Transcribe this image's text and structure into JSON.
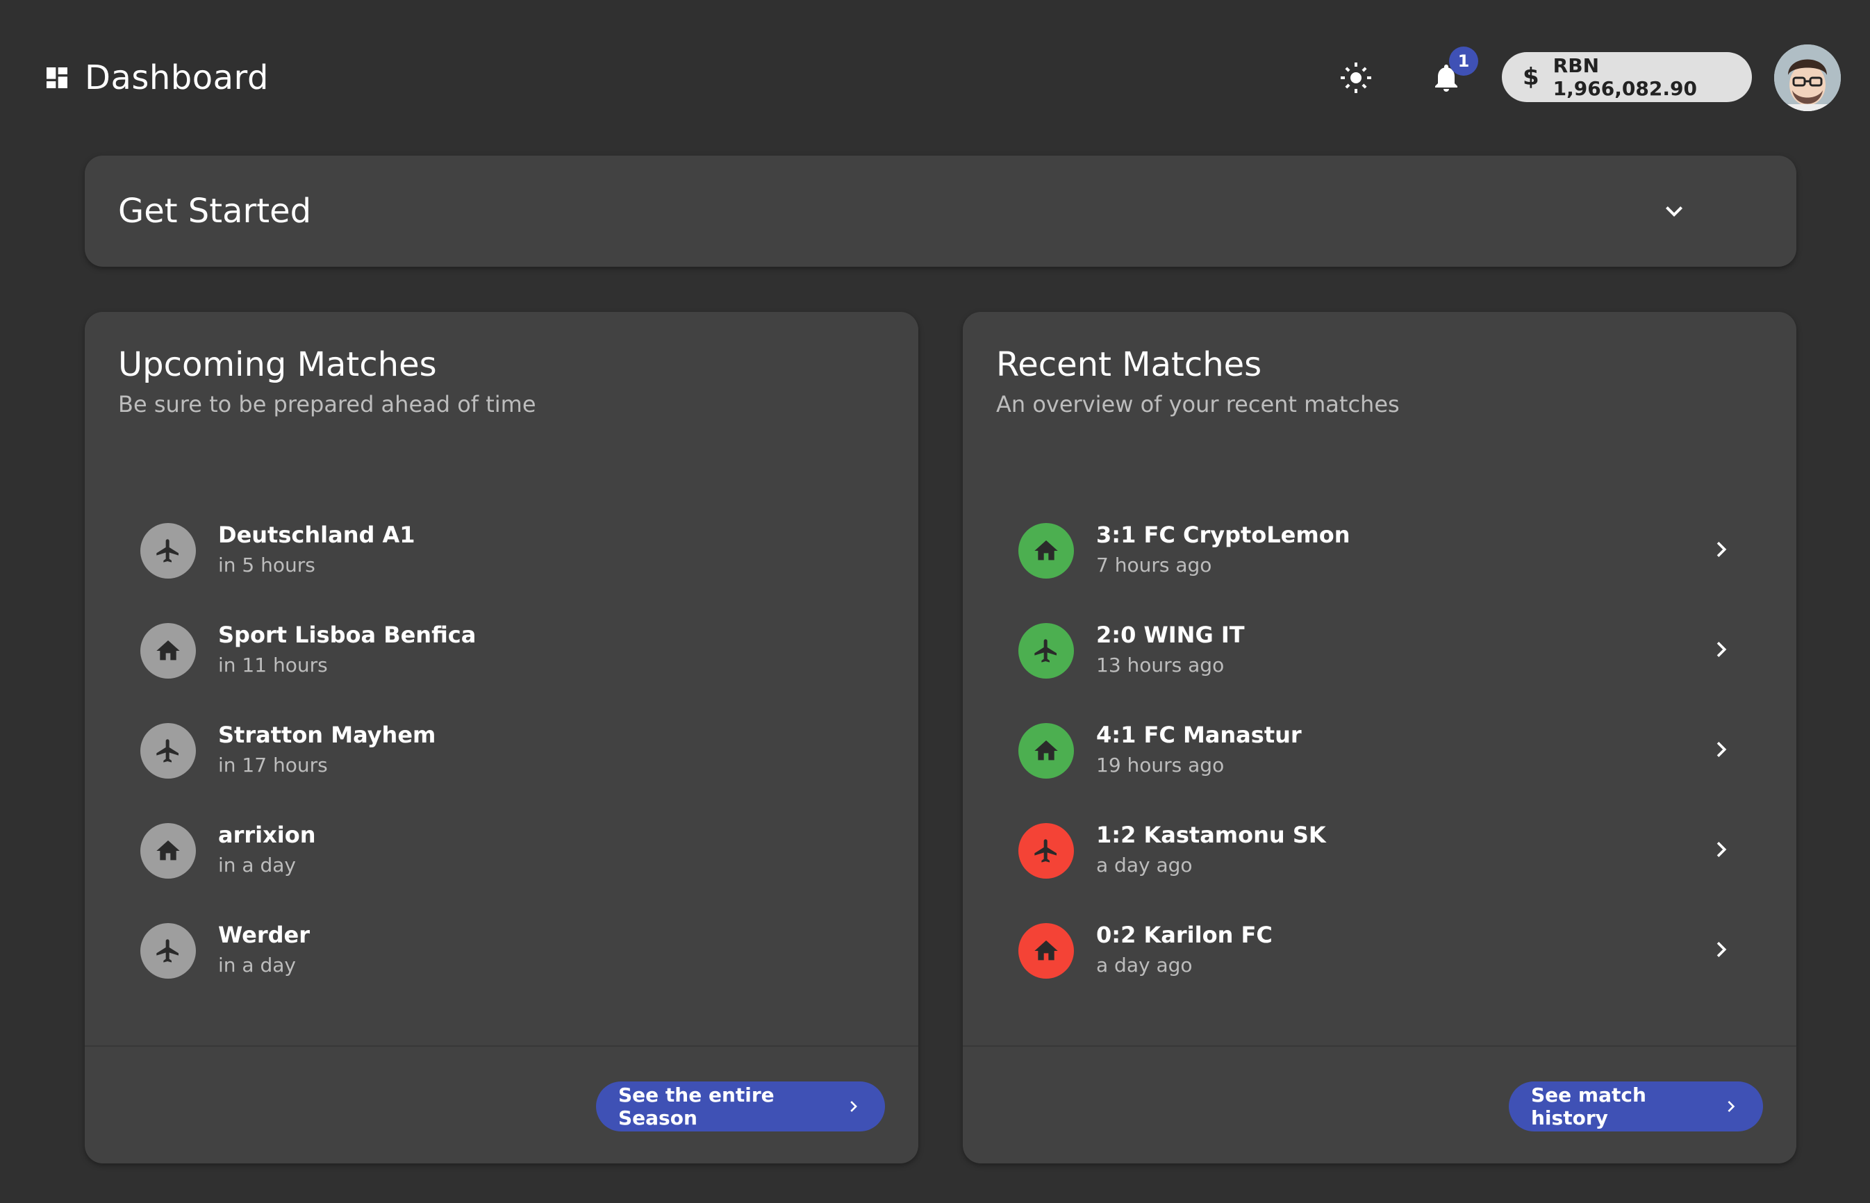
{
  "header": {
    "title": "Dashboard",
    "notification_count": "1",
    "balance_symbol": "$",
    "balance": "RBN 1,966,082.90"
  },
  "get_started": {
    "title": "Get Started"
  },
  "upcoming": {
    "title": "Upcoming Matches",
    "subtitle": "Be sure to be prepared ahead of time",
    "items": [
      {
        "team": "Deutschland A1",
        "time": "in 5 hours",
        "venue_icon": "airplane-icon"
      },
      {
        "team": "Sport Lisboa Benfica",
        "time": "in 11 hours",
        "venue_icon": "home-icon"
      },
      {
        "team": "Stratton Mayhem",
        "time": "in 17 hours",
        "venue_icon": "airplane-icon"
      },
      {
        "team": "arrixion",
        "time": "in a day",
        "venue_icon": "home-icon"
      },
      {
        "team": "Werder",
        "time": "in a day",
        "venue_icon": "airplane-icon"
      }
    ],
    "action_label": "See the entire Season"
  },
  "recent": {
    "title": "Recent Matches",
    "subtitle": "An overview of your recent matches",
    "items": [
      {
        "result": "3:1 FC CryptoLemon",
        "time": "7 hours ago",
        "venue_icon": "home-icon",
        "outcome": "win"
      },
      {
        "result": "2:0 WING IT",
        "time": "13 hours ago",
        "venue_icon": "airplane-icon",
        "outcome": "win"
      },
      {
        "result": "4:1 FC Manastur",
        "time": "19 hours ago",
        "venue_icon": "home-icon",
        "outcome": "win"
      },
      {
        "result": "1:2 Kastamonu SK",
        "time": "a day ago",
        "venue_icon": "airplane-icon",
        "outcome": "loss"
      },
      {
        "result": "0:2 Karilon FC",
        "time": "a day ago",
        "venue_icon": "home-icon",
        "outcome": "loss"
      }
    ],
    "action_label": "See match history"
  },
  "colors": {
    "background": "#303030",
    "panel": "#424242",
    "accent": "#3f51b5",
    "upcoming_icon_bg": "#9e9e9e",
    "win": "#4caf50",
    "loss": "#f44336"
  }
}
